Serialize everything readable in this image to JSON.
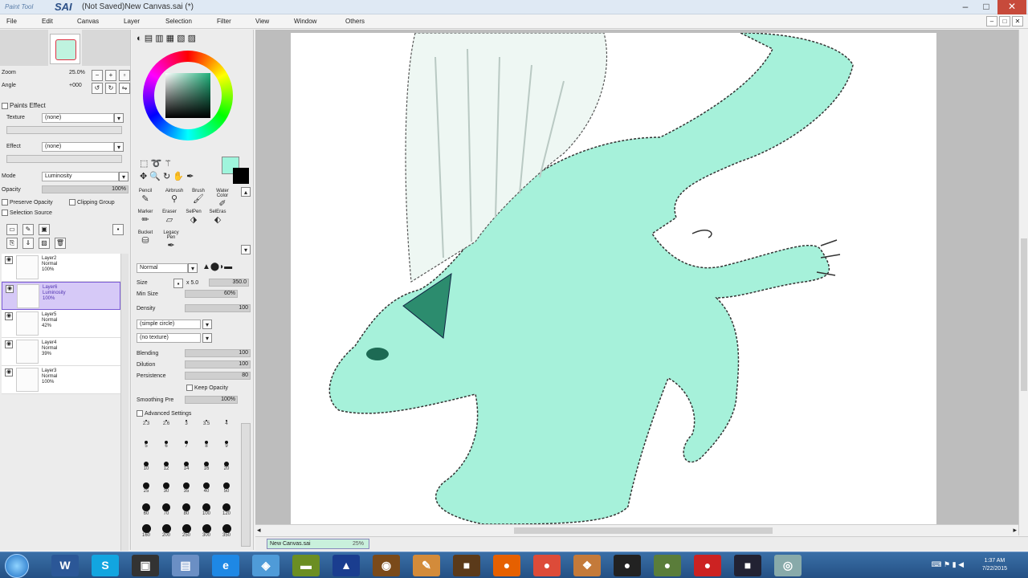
{
  "window": {
    "logo_small": "Paint Tool",
    "logo_brand": "SAI",
    "title": "(Not Saved)New Canvas.sai (*)",
    "minimize": "–",
    "maximize": "□",
    "close": "✕"
  },
  "menu": {
    "items": [
      "File",
      "Edit",
      "Canvas",
      "Layer",
      "Selection",
      "Filter",
      "View",
      "Window",
      "Others"
    ]
  },
  "navigator": {
    "zoom_label": "Zoom",
    "zoom_value": "25.0%",
    "angle_label": "Angle",
    "angle_value": "+000"
  },
  "paint_effect": {
    "header": "Paints Effect",
    "texture_label": "Texture",
    "texture_value": "(none)",
    "effect_label": "Effect",
    "effect_value": "(none)"
  },
  "layer_props": {
    "mode_label": "Mode",
    "mode_value": "Luminosity",
    "opacity_label": "Opacity",
    "opacity_value": "100%",
    "preserve_opacity": "Preserve Opacity",
    "clipping_group": "Clipping Group",
    "selection_source": "Selection Source"
  },
  "layers": [
    {
      "name": "Layer2",
      "mode": "Normal",
      "opacity": "100%",
      "selected": false
    },
    {
      "name": "Layer6",
      "mode": "Luminosity",
      "opacity": "100%",
      "selected": true
    },
    {
      "name": "Layer5",
      "mode": "Normal",
      "opacity": "42%",
      "selected": false
    },
    {
      "name": "Layer4",
      "mode": "Normal",
      "opacity": "39%",
      "selected": false
    },
    {
      "name": "Layer3",
      "mode": "Normal",
      "opacity": "100%",
      "selected": false
    }
  ],
  "tools": {
    "row1": [
      "Pencil",
      "Airbrush",
      "Brush",
      "Water Color"
    ],
    "row2": [
      "Marker",
      "Eraser",
      "SelPen",
      "SelEras"
    ],
    "row3": [
      "Bucket",
      "Legacy Pen"
    ]
  },
  "brush": {
    "blend_mode": "Normal",
    "size_label": "Size",
    "size_mult": "x 5.0",
    "size_value": "350.0",
    "min_size_label": "Min Size",
    "min_size_value": "60%",
    "density_label": "Density",
    "density_value": "100",
    "shape_value": "(simple circle)",
    "texture_value": "(no texture)",
    "blending_label": "Blending",
    "blending_value": "100",
    "dilution_label": "Dilution",
    "dilution_value": "100",
    "persistence_label": "Persistence",
    "persistence_value": "80",
    "keep_opacity": "Keep Opacity",
    "smoothing_label": "Smoothing Pre",
    "smoothing_value": "100%",
    "advanced": "Advanced Settings"
  },
  "size_presets": [
    "2.3",
    "2.6",
    "3",
    "3.5",
    "4",
    "5",
    "6",
    "7",
    "8",
    "9",
    "10",
    "12",
    "14",
    "16",
    "20",
    "25",
    "30",
    "35",
    "40",
    "50",
    "60",
    "70",
    "80",
    "100",
    "120",
    "160",
    "200",
    "250",
    "300",
    "350"
  ],
  "canvas_tab": {
    "name": "New Canvas.sai",
    "zoom": "25%"
  },
  "taskbar": {
    "apps": [
      "W",
      "S",
      "▣",
      "▤",
      "e",
      "◈",
      "▬",
      "▲",
      "◉",
      "✎",
      "■",
      "●",
      "●",
      "❖",
      "●",
      "●",
      "●",
      "■",
      "◎"
    ],
    "time": "1:37 AM",
    "date": "7/22/2015"
  }
}
